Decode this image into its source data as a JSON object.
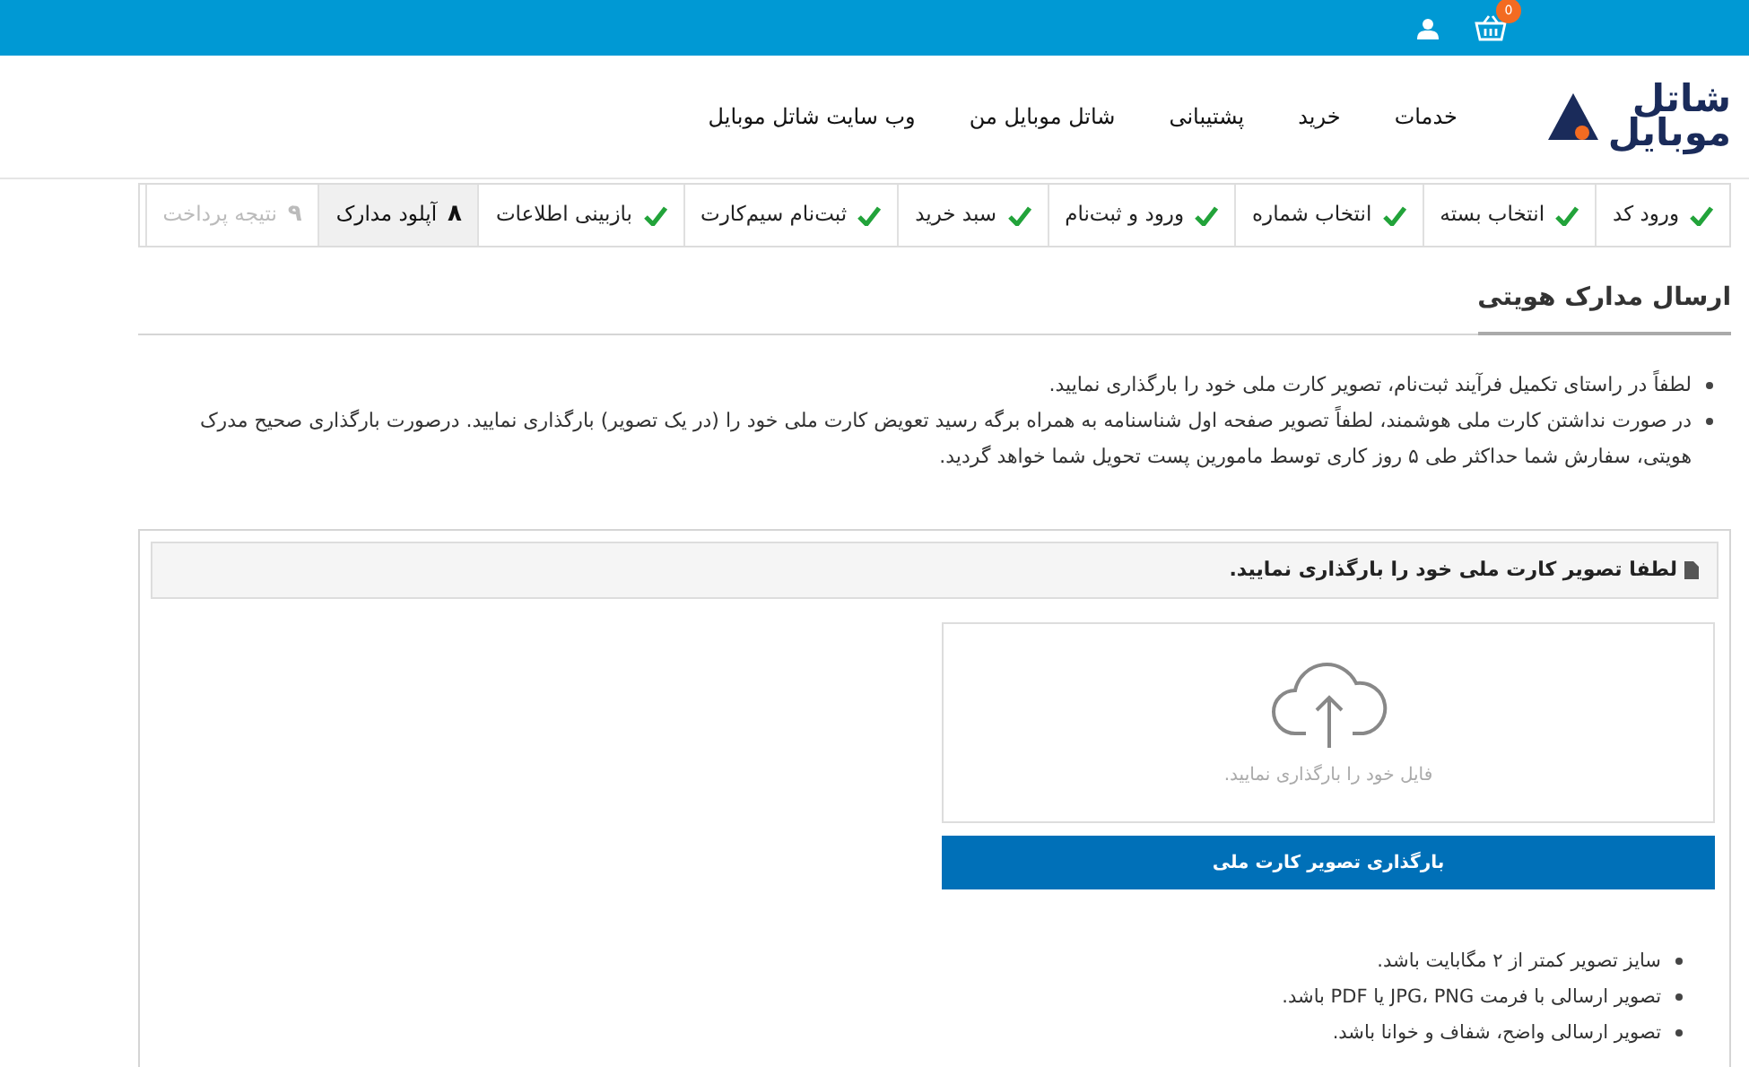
{
  "top_bar": {
    "cart_count": "0"
  },
  "logo": {
    "line1": "شاتل",
    "line2": "موبایل"
  },
  "nav": [
    "خدمات",
    "خرید",
    "پشتیبانی",
    "شاتل موبایل من",
    "وب سایت شاتل موبایل"
  ],
  "steps": [
    {
      "label": "ورود کد",
      "done": true,
      "selected": false
    },
    {
      "label": "انتخاب بسته",
      "done": true,
      "selected": false
    },
    {
      "label": "انتخاب شماره",
      "done": true,
      "selected": false
    },
    {
      "label": "ورود و ثبت‌نام",
      "done": true,
      "selected": false
    },
    {
      "label": "سبد خرید",
      "done": true,
      "selected": false
    },
    {
      "label": "ثبت‌نام سیم‌کارت",
      "done": true,
      "selected": false
    },
    {
      "label": "بازبینی اطلاعات",
      "done": true,
      "selected": false
    },
    {
      "label": "آپلود مدارک",
      "number": "۸",
      "done": false,
      "selected": true
    },
    {
      "label": "نتیجه پرداخت",
      "number": "۹",
      "done": false,
      "selected": false
    }
  ],
  "section_title": "ارسال مدارک هویتی",
  "notes": [
    "لطفاً در راستای تکمیل فرآیند ثبت‌نام، تصویر کارت ملی خود را بارگذاری نمایید.",
    "در صورت نداشتن کارت ملی هوشمند، لطفاً تصویر صفحه اول شناسنامه به همراه برگه رسید تعویض کارت ملی خود را (در یک تصویر) بارگذاری نمایید. درصورت بارگذاری صحیح مدرک هویتی، سفارش شما حداکثر طی ۵ روز کاری توسط مامورین پست تحویل شما خواهد گردید."
  ],
  "upload_panel": {
    "heading": "لطفا تصویر کارت ملی خود را بارگذاری نمایید.",
    "dropzone_text": "فایل خود را بارگذاری نمایید.",
    "button": "بارگذاری تصویر کارت ملی",
    "rules": [
      "سایز تصویر کمتر از ۲ مگابایت باشد.",
      "تصویر ارسالی با فرمت JPG، PNG یا PDF باشد.",
      "تصویر ارسالی واضح، شفاف و خوانا باشد."
    ]
  }
}
